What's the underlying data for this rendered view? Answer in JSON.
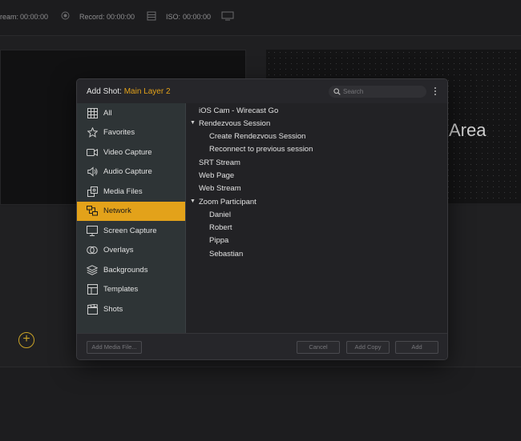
{
  "topbar": {
    "stream_label": "ream:",
    "stream_time": "00:00:00",
    "record_label": "Record:",
    "record_time": "00:00:00",
    "iso_label": "ISO:",
    "iso_time": "00:00:00"
  },
  "preview": {
    "area_text": "Area"
  },
  "dialog": {
    "title_prefix": "Add Shot: ",
    "title_layer": "Main Layer 2",
    "search_placeholder": "Search",
    "sidebar": [
      {
        "label": "All",
        "icon": "grid-icon"
      },
      {
        "label": "Favorites",
        "icon": "star-icon"
      },
      {
        "label": "Video Capture",
        "icon": "video-camera-icon"
      },
      {
        "label": "Audio Capture",
        "icon": "microphone-icon"
      },
      {
        "label": "Media Files",
        "icon": "media-files-icon"
      },
      {
        "label": "Network",
        "icon": "network-icon"
      },
      {
        "label": "Screen Capture",
        "icon": "monitor-icon"
      },
      {
        "label": "Overlays",
        "icon": "overlays-icon"
      },
      {
        "label": "Backgrounds",
        "icon": "layers-icon"
      },
      {
        "label": "Templates",
        "icon": "templates-icon"
      },
      {
        "label": "Shots",
        "icon": "clapperboard-icon"
      }
    ],
    "active_sidebar_item": "Network",
    "list": [
      {
        "label": "iOS Cam - Wirecast Go",
        "level": 0
      },
      {
        "label": "Rendezvous Session",
        "level": 0,
        "expanded": true
      },
      {
        "label": "Create Rendezvous Session",
        "level": 1
      },
      {
        "label": "Reconnect to previous session",
        "level": 1
      },
      {
        "label": "SRT Stream",
        "level": 0
      },
      {
        "label": "Web Page",
        "level": 0
      },
      {
        "label": "Web Stream",
        "level": 0
      },
      {
        "label": "Zoom Participant",
        "level": 0,
        "expanded": true
      },
      {
        "label": "Daniel",
        "level": 1
      },
      {
        "label": "Robert",
        "level": 1
      },
      {
        "label": "Pippa",
        "level": 1
      },
      {
        "label": "Sebastian",
        "level": 1
      }
    ],
    "footer": {
      "add_media_file": "Add Media File...",
      "cancel": "Cancel",
      "add_copy": "Add Copy",
      "add": "Add"
    }
  },
  "colors": {
    "accent": "#e3a21a",
    "sidebar_bg": "#2e3436",
    "dialog_bg": "#222225"
  }
}
